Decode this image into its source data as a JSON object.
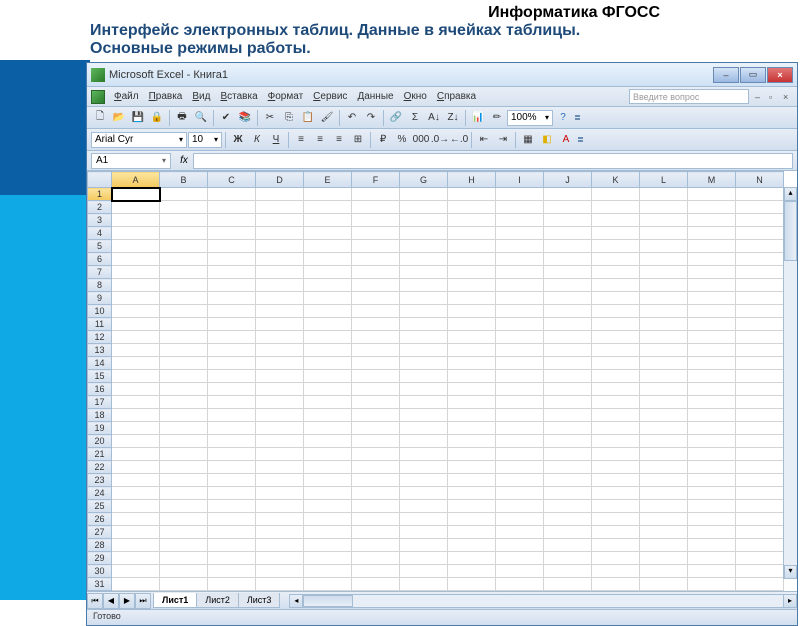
{
  "slide": {
    "header_right": "Информатика ФГОСС",
    "title_line1": "Интерфейс электронных таблиц. Данные в ячейках таблицы.",
    "title_line2": "Основные режимы работы."
  },
  "window": {
    "title": "Microsoft Excel - Книга1"
  },
  "menu": {
    "items": [
      "Файл",
      "Правка",
      "Вид",
      "Вставка",
      "Формат",
      "Сервис",
      "Данные",
      "Окно",
      "Справка"
    ],
    "help_placeholder": "Введите вопрос"
  },
  "toolbar1": {
    "zoom": "100%"
  },
  "toolbar2": {
    "font": "Arial Cyr",
    "size": "10"
  },
  "namebox": {
    "value": "A1"
  },
  "columns": [
    "A",
    "B",
    "C",
    "D",
    "E",
    "F",
    "G",
    "H",
    "I",
    "J",
    "K",
    "L",
    "M",
    "N"
  ],
  "rows_count": 31,
  "active_cell": {
    "col": "A",
    "row": 1
  },
  "sheets": [
    "Лист1",
    "Лист2",
    "Лист3"
  ],
  "active_sheet": 0,
  "status": "Готово"
}
